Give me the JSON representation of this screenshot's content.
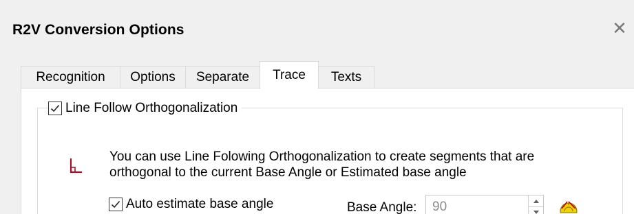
{
  "dialog": {
    "title": "R2V Conversion Options",
    "close_glyph": "✕"
  },
  "tabs": [
    {
      "label": "Recognition",
      "active": false
    },
    {
      "label": "Options",
      "active": false
    },
    {
      "label": "Separate",
      "active": false
    },
    {
      "label": "Trace",
      "active": true
    },
    {
      "label": "Texts",
      "active": false
    }
  ],
  "trace": {
    "group": {
      "label": "Line Follow Orthogonalization",
      "checked": true
    },
    "description_line1": "You can use Line Folowing Orthogonalization to create segments that are",
    "description_line2": "orthogonal to the current Base Angle or Estimated base angle",
    "auto_estimate": {
      "label": "Auto estimate base angle",
      "checked": true
    },
    "base_angle": {
      "label": "Base Angle:",
      "value": "90",
      "disabled": true
    }
  },
  "icons": {
    "ortho": "orthogonal-corner-icon",
    "protractor": "protractor-icon",
    "close": "close-icon"
  },
  "colors": {
    "ortho_icon": "#a0102a",
    "protractor_fill": "#f5d000",
    "protractor_mark": "#c00000"
  }
}
